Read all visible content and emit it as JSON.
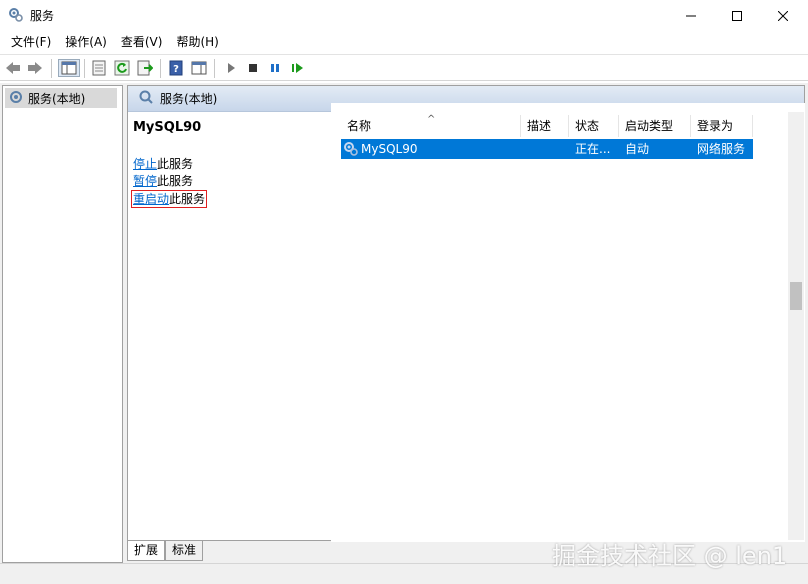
{
  "window": {
    "title": "服务"
  },
  "menu": [
    {
      "label": "文件(F)"
    },
    {
      "label": "操作(A)"
    },
    {
      "label": "查看(V)"
    },
    {
      "label": "帮助(H)"
    }
  ],
  "tree": {
    "selected_label": "服务(本地)"
  },
  "content": {
    "header_label": "服务(本地)",
    "selected_service": "MySQL90",
    "actions": [
      {
        "link": "停止",
        "suffix": "此服务"
      },
      {
        "link": "暂停",
        "suffix": "此服务"
      },
      {
        "link": "重启动",
        "suffix": "此服务"
      }
    ]
  },
  "list": {
    "columns": [
      "名称",
      "描述",
      "状态",
      "启动类型",
      "登录为"
    ],
    "rows": [
      {
        "name": "MySQL90",
        "desc": "",
        "status": "正在...",
        "startup": "自动",
        "logon": "网络服务"
      }
    ]
  },
  "tabs": [
    {
      "label": "扩展"
    },
    {
      "label": "标准"
    }
  ],
  "watermark": "掘金技术社区 @ len1"
}
